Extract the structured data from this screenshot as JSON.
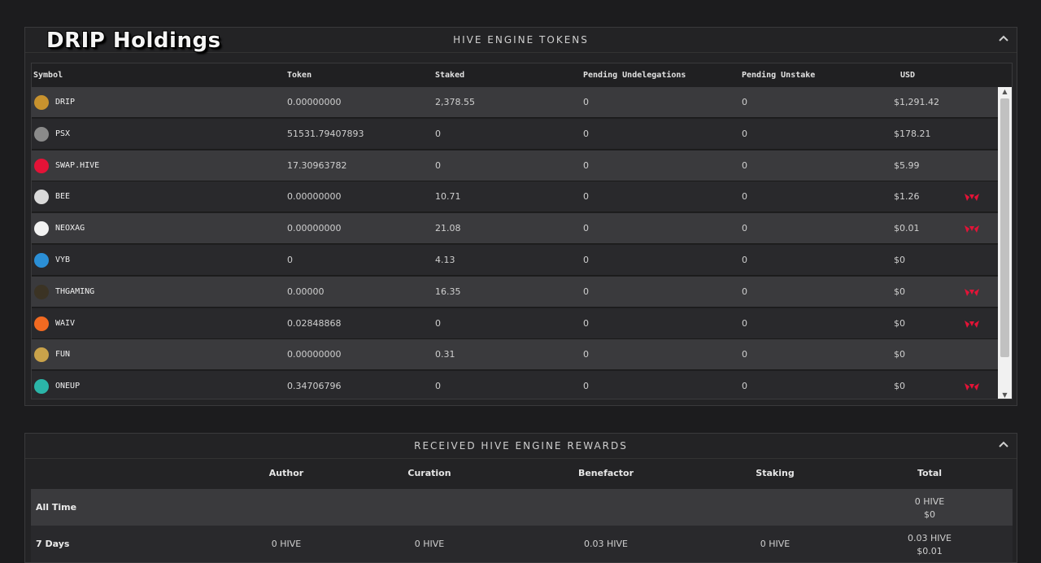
{
  "brand": {
    "title": "DRIP Holdings"
  },
  "tokens_panel": {
    "title": "HIVE ENGINE TOKENS",
    "columns": [
      "Symbol",
      "Token",
      "Staked",
      "Pending Undelegations",
      "Pending Unstake",
      "USD"
    ],
    "rows": [
      {
        "symbol": "DRIP",
        "token": "0.00000000",
        "staked": "2,378.55",
        "pending_undelegations": "0",
        "pending_unstake": "0",
        "usd": "$1,291.42",
        "icon": "drip-token-icon",
        "icon_color": "#c8922e",
        "hive_mark": false
      },
      {
        "symbol": "PSX",
        "token": "51531.79407893",
        "staked": "0",
        "pending_undelegations": "0",
        "pending_unstake": "0",
        "usd": "$178.21",
        "icon": "psx-token-icon",
        "icon_color": "#8a8a8a",
        "hive_mark": false
      },
      {
        "symbol": "SWAP.HIVE",
        "token": "17.30963782",
        "staked": "0",
        "pending_undelegations": "0",
        "pending_unstake": "0",
        "usd": "$5.99",
        "icon": "swap-hive-token-icon",
        "icon_color": "#e31337",
        "hive_mark": false
      },
      {
        "symbol": "BEE",
        "token": "0.00000000",
        "staked": "10.71",
        "pending_undelegations": "0",
        "pending_unstake": "0",
        "usd": "$1.26",
        "icon": "bee-token-icon",
        "icon_color": "#d9d9d9",
        "hive_mark": true
      },
      {
        "symbol": "NEOXAG",
        "token": "0.00000000",
        "staked": "21.08",
        "pending_undelegations": "0",
        "pending_unstake": "0",
        "usd": "$0.01",
        "icon": "neoxag-token-icon",
        "icon_color": "#f2f2f2",
        "hive_mark": true
      },
      {
        "symbol": "VYB",
        "token": "0",
        "staked": "4.13",
        "pending_undelegations": "0",
        "pending_unstake": "0",
        "usd": "$0",
        "icon": "vyb-token-icon",
        "icon_color": "#2b8fd6",
        "hive_mark": false
      },
      {
        "symbol": "THGAMING",
        "token": "0.00000",
        "staked": "16.35",
        "pending_undelegations": "0",
        "pending_unstake": "0",
        "usd": "$0",
        "icon": "thgaming-token-icon",
        "icon_color": "#3b3324",
        "hive_mark": true
      },
      {
        "symbol": "WAIV",
        "token": "0.02848868",
        "staked": "0",
        "pending_undelegations": "0",
        "pending_unstake": "0",
        "usd": "$0",
        "icon": "waiv-token-icon",
        "icon_color": "#f26a21",
        "hive_mark": true
      },
      {
        "symbol": "FUN",
        "token": "0.00000000",
        "staked": "0.31",
        "pending_undelegations": "0",
        "pending_unstake": "0",
        "usd": "$0",
        "icon": "fun-token-icon",
        "icon_color": "#c9a24a",
        "hive_mark": false
      },
      {
        "symbol": "ONEUP",
        "token": "0.34706796",
        "staked": "0",
        "pending_undelegations": "0",
        "pending_unstake": "0",
        "usd": "$0",
        "icon": "oneup-token-icon",
        "icon_color": "#2bb5a8",
        "hive_mark": true
      }
    ]
  },
  "rewards_panel": {
    "title": "RECEIVED HIVE ENGINE REWARDS",
    "columns": [
      "Author",
      "Curation",
      "Benefactor",
      "Staking",
      "Total"
    ],
    "rows": [
      {
        "label": "All Time",
        "author": "",
        "curation": "",
        "benefactor": "",
        "staking": "",
        "total_hive": "0 HIVE",
        "total_usd": "$0"
      },
      {
        "label": "7 Days",
        "author": "0 HIVE",
        "curation": "0 HIVE",
        "benefactor": "0.03 HIVE",
        "staking": "0 HIVE",
        "total_hive": "0.03 HIVE",
        "total_usd": "$0.01"
      }
    ]
  },
  "colors": {
    "hive_red": "#e31337",
    "background": "#1c1c1e",
    "row_odd": "#3a3a3d",
    "row_even": "#29292c"
  }
}
